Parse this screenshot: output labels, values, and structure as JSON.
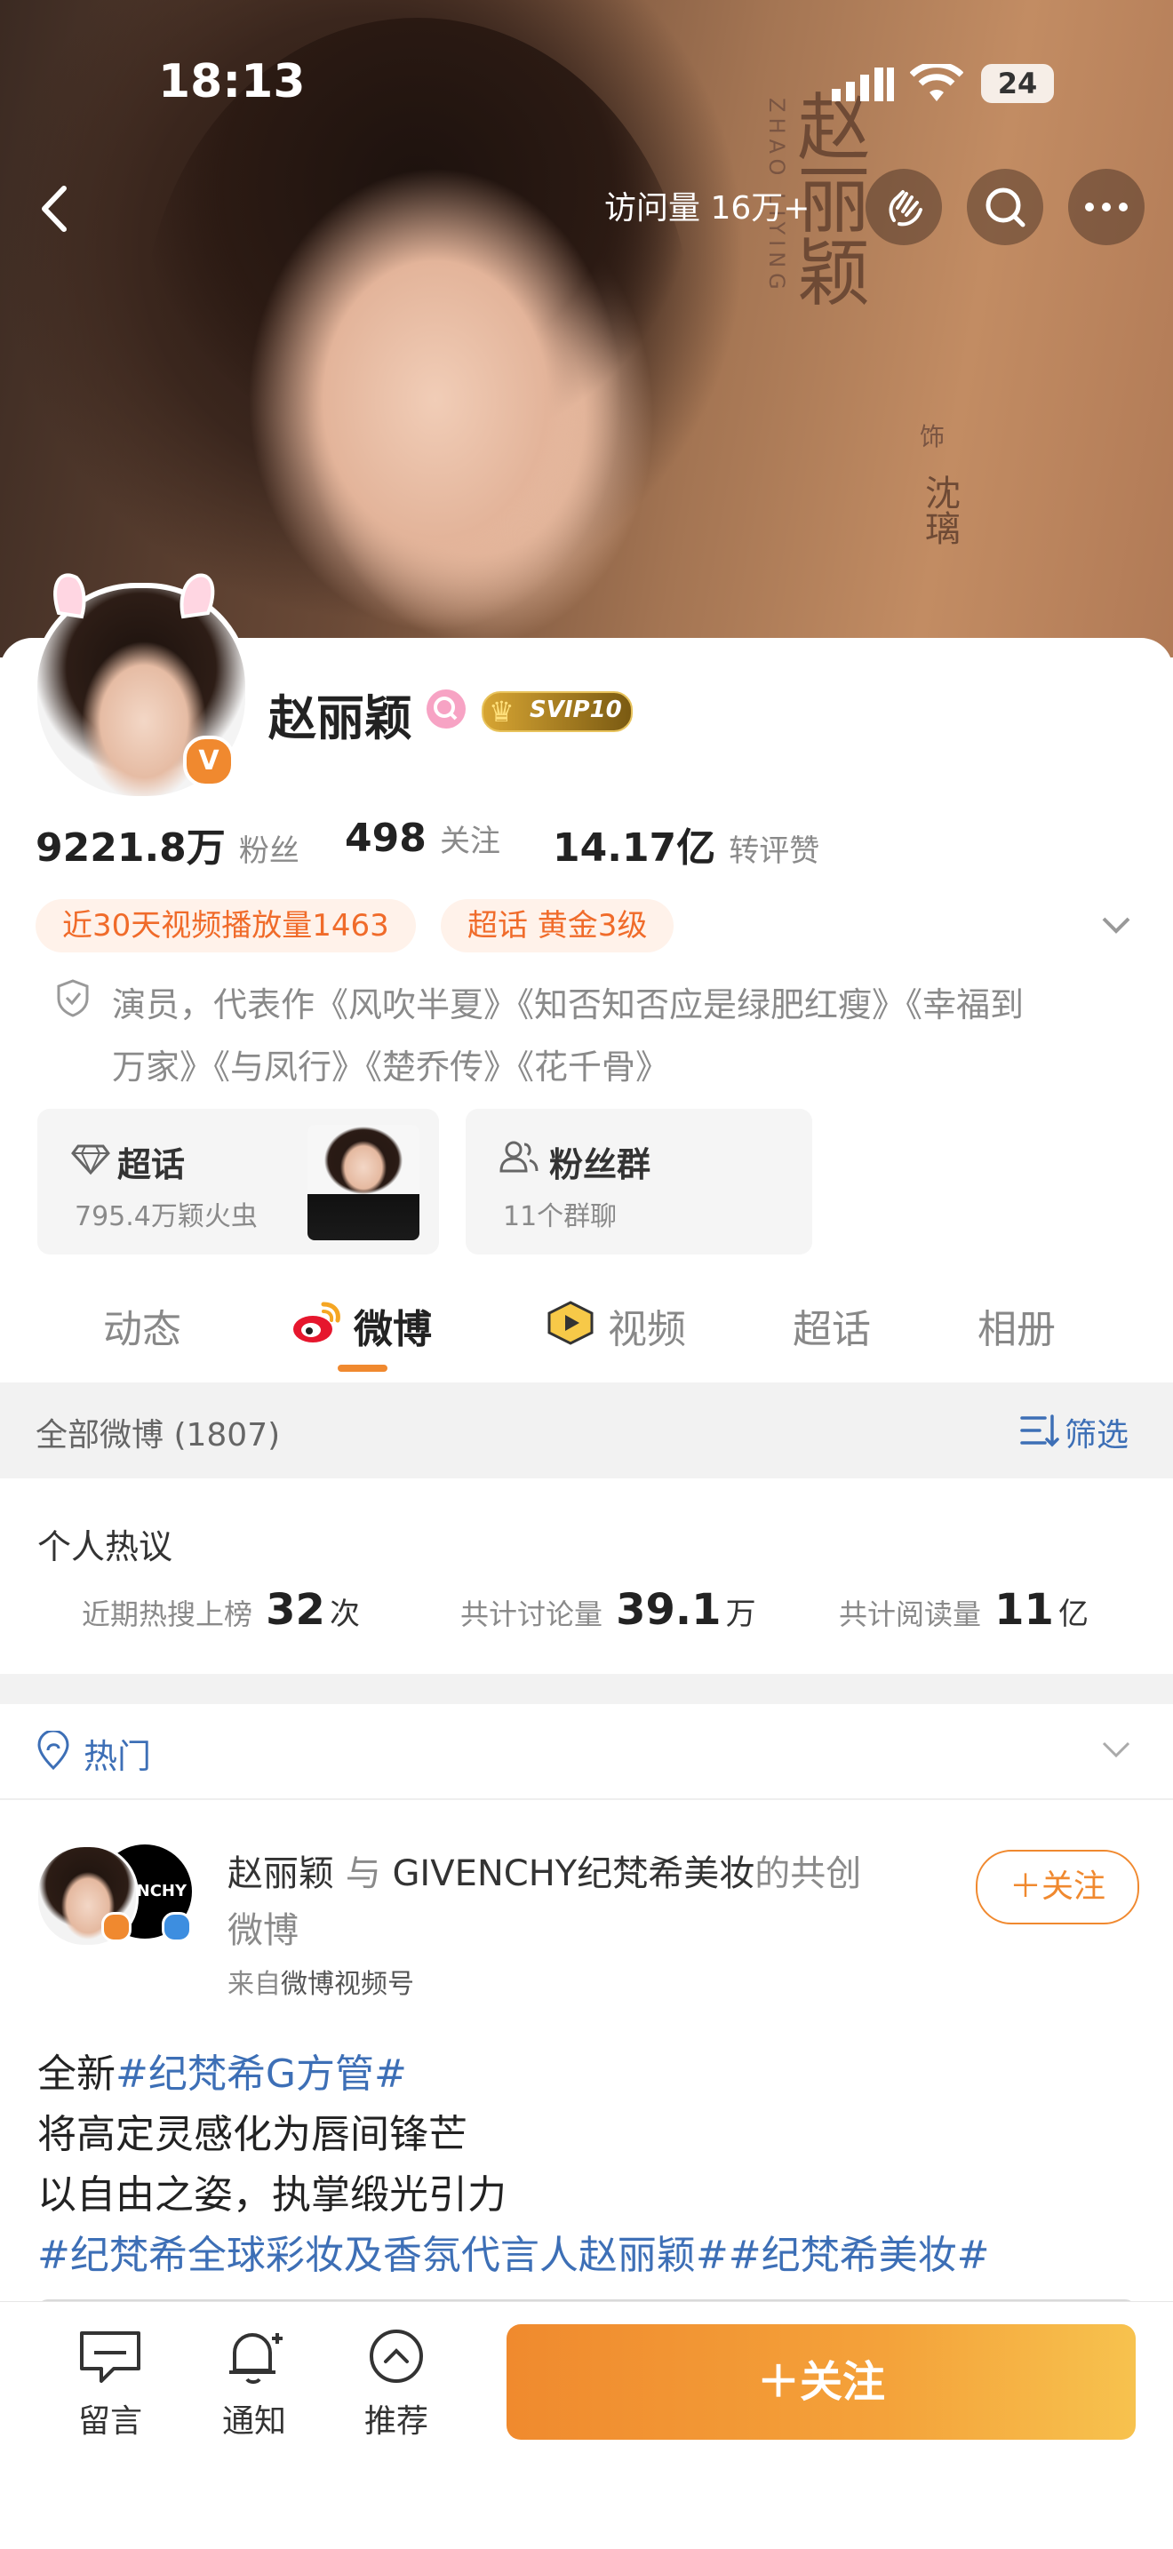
{
  "status_bar": {
    "time": "18:13",
    "battery": "24"
  },
  "header": {
    "visit_label": "访问量 16万+"
  },
  "hero": {
    "title_text": "赵丽颖",
    "pinyin": "ZHAO LIYING",
    "role_prefix": "饰",
    "role_name": "沈璃"
  },
  "profile": {
    "name": "赵丽颖",
    "svip": "SVIP10",
    "verified_mark": "V",
    "stats": [
      {
        "value": "9221.8万",
        "label": "粉丝"
      },
      {
        "value": "498",
        "label": "关注"
      },
      {
        "value": "14.17亿",
        "label": "转评赞"
      }
    ],
    "tags": [
      "近30天视频播放量1463",
      "超话 黄金3级"
    ],
    "bio": "演员，代表作《风吹半夏》《知否知否应是绿肥红瘦》《幸福到万家》《与凤行》《楚乔传》《花千骨》",
    "bio_line1": "演员，代表作《风吹半夏》《知否知否应是绿肥红瘦》《幸福到",
    "bio_line2": "万家》《与凤行》《楚乔传》《花千骨》"
  },
  "cards": {
    "supertopic": {
      "title": "超话",
      "sub": "795.4万颖火虫"
    },
    "fans_group": {
      "title": "粉丝群",
      "sub": "11个群聊"
    }
  },
  "tabs": [
    "动态",
    "微博",
    "视频",
    "超话",
    "相册"
  ],
  "filter_bar": {
    "label": "全部微博 (1807)",
    "filter": "筛选"
  },
  "hot_discussion": {
    "title": "个人热议",
    "items": [
      {
        "label": "近期热搜上榜",
        "value": "32",
        "unit": "次"
      },
      {
        "label": "共计讨论量",
        "value": "39.1",
        "unit": "万"
      },
      {
        "label": "共计阅读量",
        "value": "11",
        "unit": "亿"
      }
    ]
  },
  "hot_section": {
    "title": "热门"
  },
  "post": {
    "author": "赵丽颖",
    "with_word": "与",
    "partner": "GIVENCHY纪梵希美妆",
    "cocreate": "的共创",
    "cocreate2": "微博",
    "partner_avatar_text": "ENCHY",
    "source_prefix": "来自",
    "source": "微博视频号",
    "follow": "关注",
    "line1_prefix": "全新",
    "line1_tag": "#纪梵希G方管#",
    "line2": "将高定灵感化为唇间锋芒",
    "line3": "以自由之姿，执掌缎光引力",
    "line4_tag": "#纪梵希全球彩妆及香氛代言人赵丽颖##纪梵希美妆#"
  },
  "bottom_bar": {
    "items": [
      "留言",
      "通知",
      "推荐"
    ],
    "follow_button": "关注"
  },
  "colors": {
    "accent": "#f0892f",
    "link": "#3d6fb6",
    "orange_text": "#f06b2a"
  }
}
